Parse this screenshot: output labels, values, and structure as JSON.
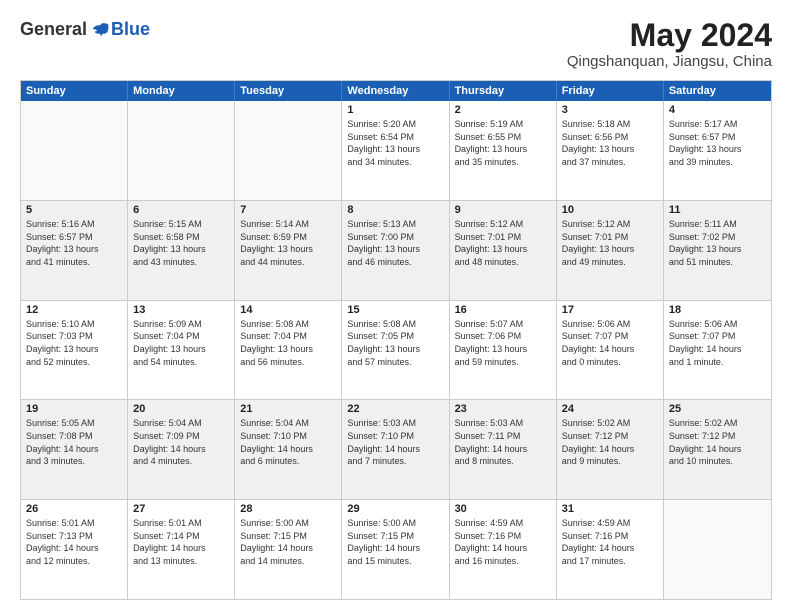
{
  "header": {
    "logo": {
      "general": "General",
      "blue": "Blue"
    },
    "title": "May 2024",
    "location": "Qingshanquan, Jiangsu, China"
  },
  "weekdays": [
    "Sunday",
    "Monday",
    "Tuesday",
    "Wednesday",
    "Thursday",
    "Friday",
    "Saturday"
  ],
  "weeks": [
    [
      {
        "day": "",
        "text": ""
      },
      {
        "day": "",
        "text": ""
      },
      {
        "day": "",
        "text": ""
      },
      {
        "day": "1",
        "text": "Sunrise: 5:20 AM\nSunset: 6:54 PM\nDaylight: 13 hours\nand 34 minutes."
      },
      {
        "day": "2",
        "text": "Sunrise: 5:19 AM\nSunset: 6:55 PM\nDaylight: 13 hours\nand 35 minutes."
      },
      {
        "day": "3",
        "text": "Sunrise: 5:18 AM\nSunset: 6:56 PM\nDaylight: 13 hours\nand 37 minutes."
      },
      {
        "day": "4",
        "text": "Sunrise: 5:17 AM\nSunset: 6:57 PM\nDaylight: 13 hours\nand 39 minutes."
      }
    ],
    [
      {
        "day": "5",
        "text": "Sunrise: 5:16 AM\nSunset: 6:57 PM\nDaylight: 13 hours\nand 41 minutes."
      },
      {
        "day": "6",
        "text": "Sunrise: 5:15 AM\nSunset: 6:58 PM\nDaylight: 13 hours\nand 43 minutes."
      },
      {
        "day": "7",
        "text": "Sunrise: 5:14 AM\nSunset: 6:59 PM\nDaylight: 13 hours\nand 44 minutes."
      },
      {
        "day": "8",
        "text": "Sunrise: 5:13 AM\nSunset: 7:00 PM\nDaylight: 13 hours\nand 46 minutes."
      },
      {
        "day": "9",
        "text": "Sunrise: 5:12 AM\nSunset: 7:01 PM\nDaylight: 13 hours\nand 48 minutes."
      },
      {
        "day": "10",
        "text": "Sunrise: 5:12 AM\nSunset: 7:01 PM\nDaylight: 13 hours\nand 49 minutes."
      },
      {
        "day": "11",
        "text": "Sunrise: 5:11 AM\nSunset: 7:02 PM\nDaylight: 13 hours\nand 51 minutes."
      }
    ],
    [
      {
        "day": "12",
        "text": "Sunrise: 5:10 AM\nSunset: 7:03 PM\nDaylight: 13 hours\nand 52 minutes."
      },
      {
        "day": "13",
        "text": "Sunrise: 5:09 AM\nSunset: 7:04 PM\nDaylight: 13 hours\nand 54 minutes."
      },
      {
        "day": "14",
        "text": "Sunrise: 5:08 AM\nSunset: 7:04 PM\nDaylight: 13 hours\nand 56 minutes."
      },
      {
        "day": "15",
        "text": "Sunrise: 5:08 AM\nSunset: 7:05 PM\nDaylight: 13 hours\nand 57 minutes."
      },
      {
        "day": "16",
        "text": "Sunrise: 5:07 AM\nSunset: 7:06 PM\nDaylight: 13 hours\nand 59 minutes."
      },
      {
        "day": "17",
        "text": "Sunrise: 5:06 AM\nSunset: 7:07 PM\nDaylight: 14 hours\nand 0 minutes."
      },
      {
        "day": "18",
        "text": "Sunrise: 5:06 AM\nSunset: 7:07 PM\nDaylight: 14 hours\nand 1 minute."
      }
    ],
    [
      {
        "day": "19",
        "text": "Sunrise: 5:05 AM\nSunset: 7:08 PM\nDaylight: 14 hours\nand 3 minutes."
      },
      {
        "day": "20",
        "text": "Sunrise: 5:04 AM\nSunset: 7:09 PM\nDaylight: 14 hours\nand 4 minutes."
      },
      {
        "day": "21",
        "text": "Sunrise: 5:04 AM\nSunset: 7:10 PM\nDaylight: 14 hours\nand 6 minutes."
      },
      {
        "day": "22",
        "text": "Sunrise: 5:03 AM\nSunset: 7:10 PM\nDaylight: 14 hours\nand 7 minutes."
      },
      {
        "day": "23",
        "text": "Sunrise: 5:03 AM\nSunset: 7:11 PM\nDaylight: 14 hours\nand 8 minutes."
      },
      {
        "day": "24",
        "text": "Sunrise: 5:02 AM\nSunset: 7:12 PM\nDaylight: 14 hours\nand 9 minutes."
      },
      {
        "day": "25",
        "text": "Sunrise: 5:02 AM\nSunset: 7:12 PM\nDaylight: 14 hours\nand 10 minutes."
      }
    ],
    [
      {
        "day": "26",
        "text": "Sunrise: 5:01 AM\nSunset: 7:13 PM\nDaylight: 14 hours\nand 12 minutes."
      },
      {
        "day": "27",
        "text": "Sunrise: 5:01 AM\nSunset: 7:14 PM\nDaylight: 14 hours\nand 13 minutes."
      },
      {
        "day": "28",
        "text": "Sunrise: 5:00 AM\nSunset: 7:15 PM\nDaylight: 14 hours\nand 14 minutes."
      },
      {
        "day": "29",
        "text": "Sunrise: 5:00 AM\nSunset: 7:15 PM\nDaylight: 14 hours\nand 15 minutes."
      },
      {
        "day": "30",
        "text": "Sunrise: 4:59 AM\nSunset: 7:16 PM\nDaylight: 14 hours\nand 16 minutes."
      },
      {
        "day": "31",
        "text": "Sunrise: 4:59 AM\nSunset: 7:16 PM\nDaylight: 14 hours\nand 17 minutes."
      },
      {
        "day": "",
        "text": ""
      }
    ]
  ]
}
